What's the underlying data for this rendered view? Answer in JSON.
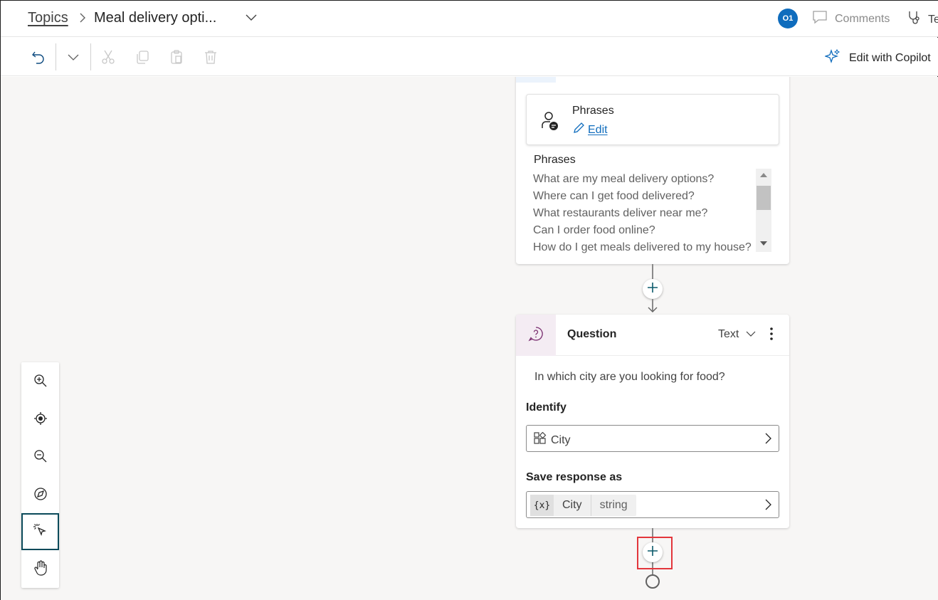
{
  "header": {
    "breadcrumb_root": "Topics",
    "title": "Meal delivery opti...",
    "avatar_initials": "O1",
    "comments_label": "Comments",
    "test_label": "Te"
  },
  "toolbar": {
    "edit_with_copilot": "Edit with Copilot",
    "icons": [
      "undo-icon",
      "chevron-down-icon",
      "cut-icon",
      "copy-icon",
      "paste-icon",
      "delete-icon"
    ]
  },
  "trigger": {
    "phrases_title": "Phrases",
    "edit_label": "Edit",
    "phrases_label": "Phrases",
    "phrases": [
      "What are my meal delivery options?",
      "Where can I get food delivered?",
      "What restaurants deliver near me?",
      "Can I order food online?",
      "How do I get meals delivered to my house?"
    ]
  },
  "question": {
    "title": "Question",
    "type": "Text",
    "prompt": "In which city are you looking for food?",
    "identify_label": "Identify",
    "identify_value": "City",
    "save_label": "Save response as",
    "variable_icon": "{x}",
    "variable_name": "City",
    "variable_type": "string"
  },
  "colors": {
    "accent": "#0f6cbd",
    "highlight": "#e3363c",
    "question_icon_bg": "#f4ecf3",
    "question_icon": "#7a2f70"
  }
}
